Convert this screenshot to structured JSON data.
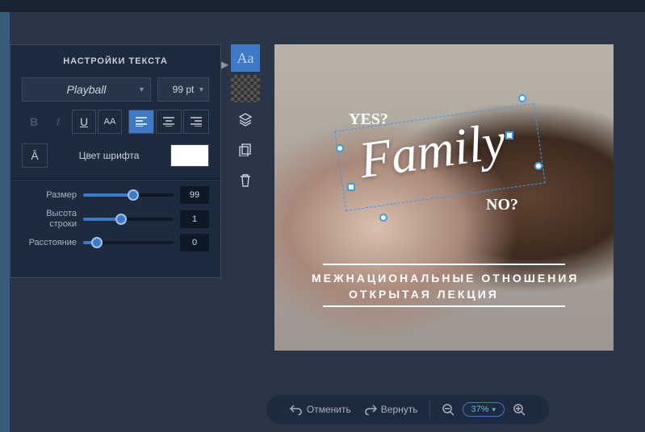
{
  "panel": {
    "title": "НАСТРОЙКИ ТЕКСТА",
    "font": "Playball",
    "font_size_label": "99 pt",
    "buttons": {
      "bold": "B",
      "italic": "I",
      "underline": "U",
      "uppercase": "AA",
      "case": "Ā"
    },
    "color_label": "Цвет шрифта",
    "color_value": "#ffffff",
    "sliders": {
      "size": {
        "label": "Размер",
        "value": "99",
        "pct": 55
      },
      "line_height": {
        "label": "Высота строки",
        "value": "1",
        "pct": 42
      },
      "spacing": {
        "label": "Расстояние",
        "value": "0",
        "pct": 15
      }
    }
  },
  "tools": [
    "text",
    "transparency",
    "layers",
    "duplicate",
    "delete"
  ],
  "canvas": {
    "yes": "YES?",
    "no": "NO?",
    "family": "Family",
    "sub1": "МЕЖНАЦИОНАЛЬНЫЕ ОТНОШЕНИЯ",
    "sub2": "ОТКРЫТАЯ ЛЕКЦИЯ"
  },
  "bottom": {
    "undo": "Отменить",
    "redo": "Вернуть",
    "zoom": "37%"
  }
}
